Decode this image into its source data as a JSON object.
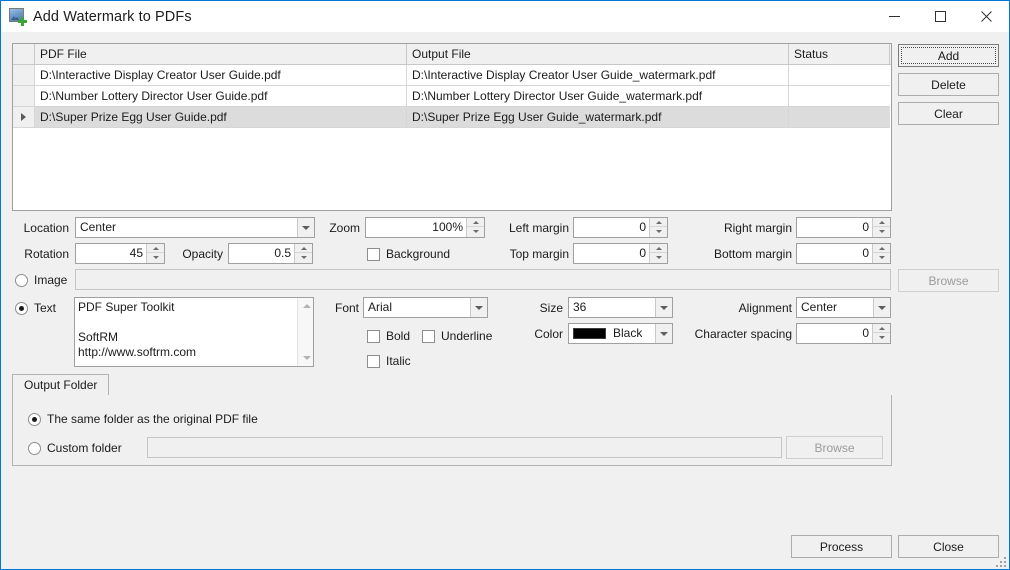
{
  "window": {
    "title": "Add Watermark to PDFs",
    "icon": "watermark-add-icon",
    "minimize": "minimize-icon",
    "maximize": "maximize-icon",
    "close": "close-icon",
    "accent_color": "#0078d7",
    "background_color": "#f0f0f0"
  },
  "grid": {
    "columns": [
      "",
      "PDF File",
      "Output File",
      "Status"
    ],
    "rows": [
      {
        "indicator": "",
        "pdf_file": "D:\\Interactive Display Creator User Guide.pdf",
        "output_file": "D:\\Interactive Display Creator User Guide_watermark.pdf",
        "status": "",
        "selected": false
      },
      {
        "indicator": "",
        "pdf_file": "D:\\Number Lottery Director User Guide.pdf",
        "output_file": "D:\\Number Lottery Director User Guide_watermark.pdf",
        "status": "",
        "selected": false
      },
      {
        "indicator": "row-arrow",
        "pdf_file": "D:\\Super Prize Egg User Guide.pdf",
        "output_file": "D:\\Super Prize Egg User Guide_watermark.pdf",
        "status": "",
        "selected": true
      }
    ]
  },
  "side_buttons": {
    "add": "Add",
    "delete": "Delete",
    "clear": "Clear"
  },
  "settings": {
    "location_label": "Location",
    "location_value": "Center",
    "zoom_label": "Zoom",
    "zoom_value": "100%",
    "left_margin_label": "Left margin",
    "left_margin_value": "0",
    "right_margin_label": "Right margin",
    "right_margin_value": "0",
    "rotation_label": "Rotation",
    "rotation_value": "45",
    "opacity_label": "Opacity",
    "opacity_value": "0.5",
    "background_label": "Background",
    "background_checked": false,
    "top_margin_label": "Top margin",
    "top_margin_value": "0",
    "bottom_margin_label": "Bottom margin",
    "bottom_margin_value": "0"
  },
  "source": {
    "image_label": "Image",
    "image_selected": false,
    "image_path": "",
    "image_browse": "Browse",
    "text_label": "Text",
    "text_selected": true,
    "text_value": "PDF Super Toolkit\n\nSoftRM\nhttp://www.softrm.com"
  },
  "font": {
    "font_label": "Font",
    "font_value": "Arial",
    "size_label": "Size",
    "size_value": "36",
    "bold_label": "Bold",
    "bold_checked": false,
    "underline_label": "Underline",
    "underline_checked": false,
    "italic_label": "Italic",
    "italic_checked": false,
    "color_label": "Color",
    "color_value": "Black",
    "color_hex": "#000000",
    "alignment_label": "Alignment",
    "alignment_value": "Center",
    "character_spacing_label": "Character spacing",
    "character_spacing_value": "0"
  },
  "output_folder": {
    "tab_label": "Output Folder",
    "same_folder_label": "The same folder as the original PDF file",
    "same_folder_selected": true,
    "custom_folder_label": "Custom folder",
    "custom_folder_selected": false,
    "custom_folder_path": "",
    "browse_label": "Browse"
  },
  "footer": {
    "process": "Process",
    "close": "Close"
  }
}
